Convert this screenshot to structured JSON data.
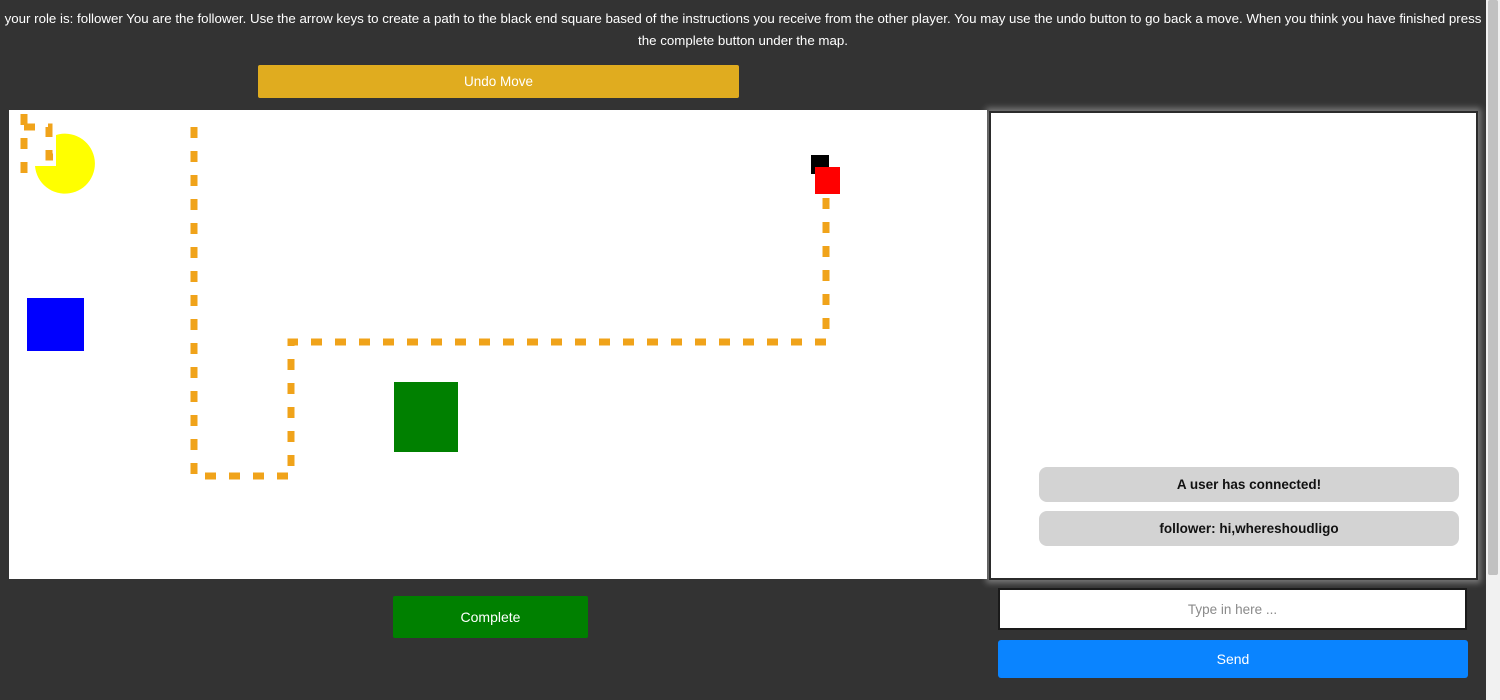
{
  "instructions": {
    "text": "your role is: follower You are the follower. Use the arrow keys to create a path to the black end square based of the instructions you receive from the other player. You may use the undo button to go back a move. When you think you have finished press the complete button under the map."
  },
  "controls": {
    "undo_label": "Undo Move",
    "complete_label": "Complete"
  },
  "map": {
    "path_color": "#f0a31a",
    "landmarks": [
      {
        "shape": "pacman",
        "color": "#ffff00"
      },
      {
        "shape": "square",
        "color": "#0000ff"
      },
      {
        "shape": "square",
        "color": "#008000"
      },
      {
        "shape": "end-square",
        "color": "#000000"
      },
      {
        "shape": "player-square",
        "color": "#ff0000"
      }
    ]
  },
  "chat": {
    "messages": [
      {
        "text": "A user has connected!"
      },
      {
        "text": "follower: hi,whereshoudligo"
      }
    ],
    "input_value": "",
    "input_placeholder": "Type in here ...",
    "send_label": "Send"
  }
}
